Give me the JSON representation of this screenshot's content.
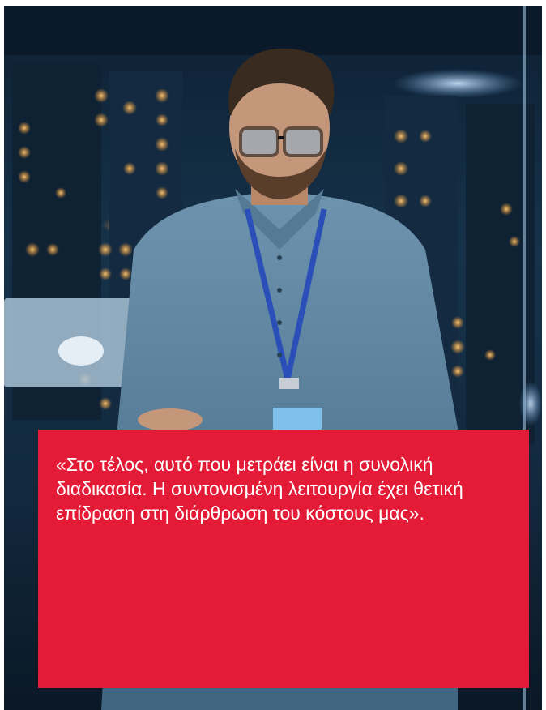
{
  "photo": {
    "subject": "man-with-glasses-in-server-room",
    "colors": {
      "background": "#12283d",
      "shirt": "#5a7f9a",
      "lanyard": "#2b4fb8",
      "lights": "#f0a040",
      "card": "#e31b36"
    }
  },
  "quote": {
    "text": "«Στο τέλος, αυτό που μετράει είναι η συνολική διαδικασία. Η συντονισμένη λειτουργία έχει θετική επίδραση στη διάρθρωση του κόστους μας».",
    "text_color": "#ffffff"
  }
}
